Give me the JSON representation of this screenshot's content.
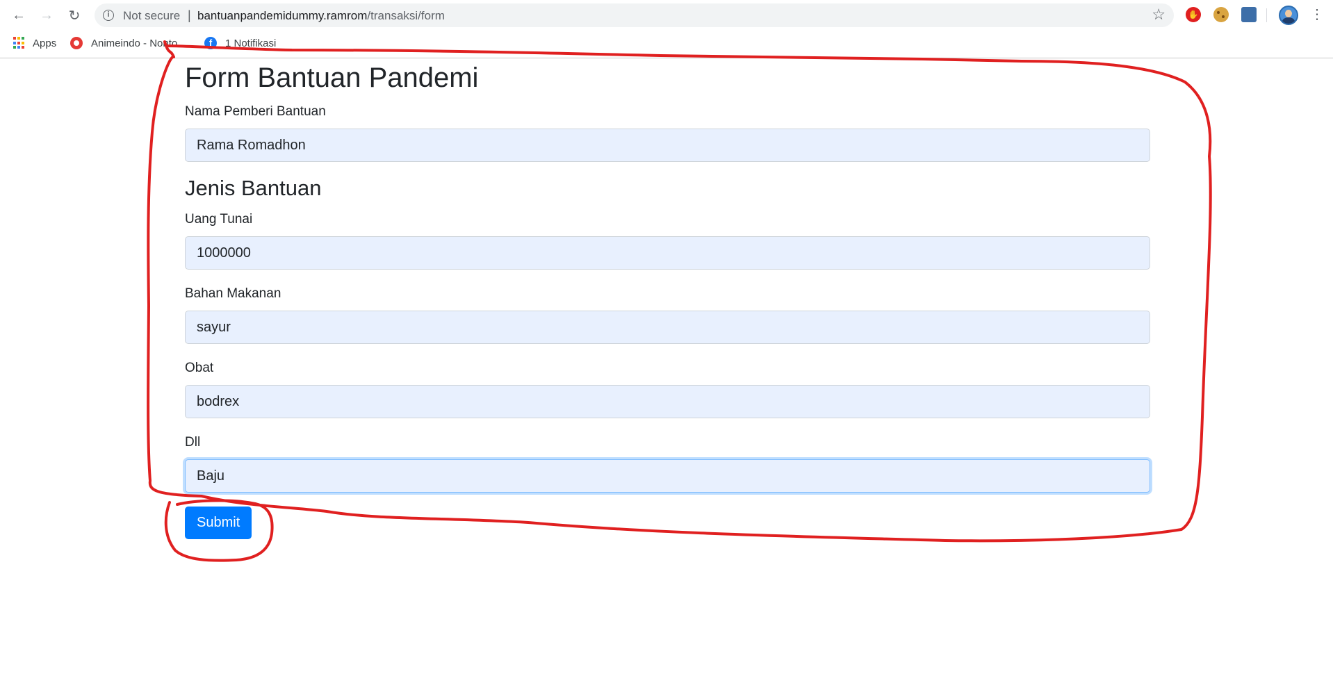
{
  "browser": {
    "security_label": "Not secure",
    "separator": "|",
    "url_host": "bantuanpandemidummy.ramrom",
    "url_path": "/transaksi/form",
    "icons": [
      "back-arrow-icon",
      "forward-arrow-icon",
      "reload-icon",
      "info-icon",
      "star-icon",
      "adblock-icon",
      "cookie-icon",
      "extension-icon",
      "avatar",
      "menu-icon"
    ]
  },
  "bookmarks": {
    "apps_label": "Apps",
    "item1_label": "Animeindo - Nonto...",
    "item2_label": "1 Notifikasi"
  },
  "form": {
    "title": "Form Bantuan Pandemi",
    "nama": {
      "label": "Nama Pemberi Bantuan",
      "value": "Rama Romadhon"
    },
    "section_title": "Jenis Bantuan",
    "uang": {
      "label": "Uang Tunai",
      "value": "1000000"
    },
    "makanan": {
      "label": "Bahan Makanan",
      "value": "sayur"
    },
    "obat": {
      "label": "Obat",
      "value": "bodrex"
    },
    "dll": {
      "label": "Dll",
      "value": "Baju"
    },
    "submit_label": "Submit"
  },
  "colors": {
    "primary": "#007bff",
    "input_bg": "#e8f0fe",
    "annotation": "#e02020"
  }
}
